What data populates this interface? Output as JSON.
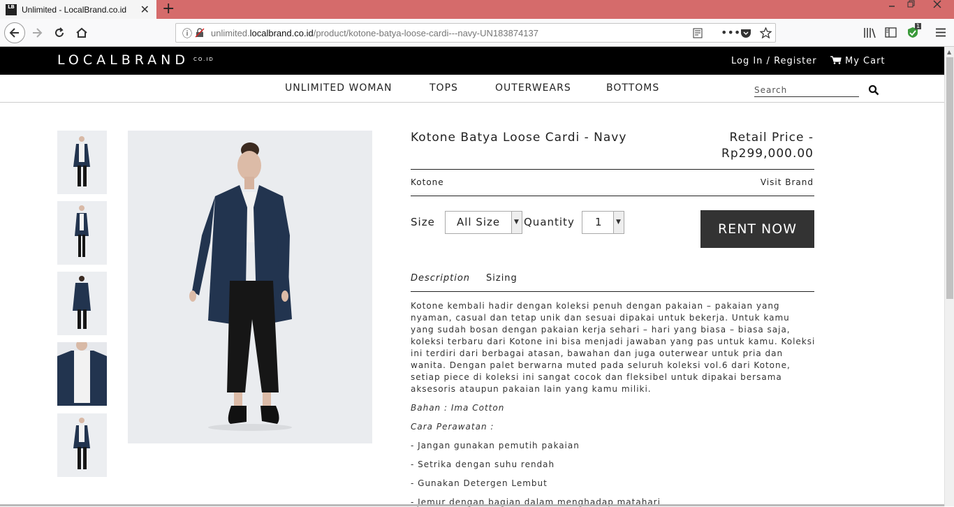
{
  "browser": {
    "tab_title": "Unlimited - LocalBrand.co.id",
    "favicon_text": "LB",
    "url_prefix": "unlimited.",
    "url_domain": "localbrand.co.id",
    "url_path": "/product/kotone-batya-loose-cardi---navy-UN183874137",
    "extension_badge": "1"
  },
  "header": {
    "logo": "LOCALBRAND",
    "logo_suffix": "CO.ID",
    "login": "Log In / Register",
    "cart": "My Cart"
  },
  "nav": {
    "items": [
      "UNLIMITED WOMAN",
      "TOPS",
      "OUTERWEARS",
      "BOTTOMS"
    ],
    "search_placeholder": "Search"
  },
  "product": {
    "name": "Kotone Batya Loose Cardi - Navy",
    "price_label": "Retail Price -",
    "price": "Rp299,000.00",
    "brand": "Kotone",
    "visit_brand": "Visit Brand",
    "size_label": "Size",
    "size_value": "All Size",
    "quantity_label": "Quantity",
    "quantity_value": "1",
    "rent_button": "RENT NOW",
    "tabs": [
      "Description",
      "Sizing"
    ],
    "description": "Kotone kembali hadir dengan koleksi penuh dengan pakaian – pakaian yang nyaman, casual dan tetap unik dan sesuai dipakai untuk bekerja. Untuk kamu yang sudah bosan dengan pakaian kerja sehari – hari yang biasa – biasa saja, koleksi terbaru dari Kotone ini bisa menjadi jawaban yang pas untuk kamu. Koleksi ini terdiri dari berbagai atasan, bawahan dan juga outerwear untuk pria dan wanita. Dengan palet berwarna muted pada seluruh koleksi vol.6 dari Kotone, setiap piece di koleksi ini sangat cocok dan fleksibel untuk dipakai bersama aksesoris ataupun pakaian lain yang kamu miliki.",
    "material": "Bahan : Ima Cotton",
    "care_title": "Cara Perawatan :",
    "care_items": [
      "- Jangan gunakan pemutih pakaian",
      "- Setrika dengan suhu rendah",
      "- Gunakan Detergen Lembut",
      "- Jemur dengan bagian dalam menghadap matahari"
    ]
  },
  "colors": {
    "header_bg": "#000000",
    "tabbar_bg": "#d56b6b",
    "rent_button_bg": "#333333",
    "cardigan_navy": "#22344f"
  }
}
